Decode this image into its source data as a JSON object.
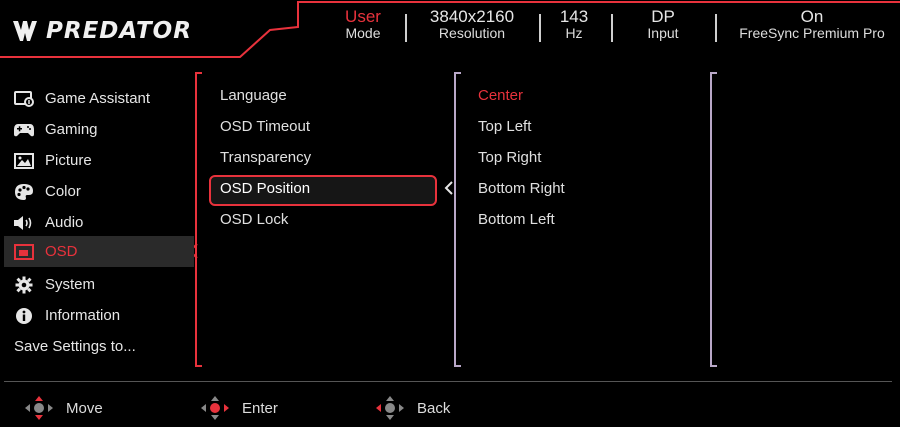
{
  "brand": {
    "name": "PREDATOR"
  },
  "status_bar": [
    {
      "value": "User",
      "label": "Mode",
      "value_color": "#e8323c"
    },
    {
      "value": "3840x2160",
      "label": "Resolution"
    },
    {
      "value": "143",
      "label": "Hz"
    },
    {
      "value": "DP",
      "label": "Input"
    },
    {
      "value": "On",
      "label": "FreeSync Premium Pro"
    }
  ],
  "main_menu": [
    {
      "label": "Game Assistant",
      "icon": "game-assistant-icon"
    },
    {
      "label": "Gaming",
      "icon": "gamepad-icon"
    },
    {
      "label": "Picture",
      "icon": "picture-icon"
    },
    {
      "label": "Color",
      "icon": "palette-icon"
    },
    {
      "label": "Audio",
      "icon": "speaker-icon"
    },
    {
      "label": "OSD",
      "icon": "osd-icon",
      "selected": true
    },
    {
      "label": "System",
      "icon": "gear-icon"
    },
    {
      "label": "Information",
      "icon": "info-icon"
    },
    {
      "label": "Save Settings to..."
    }
  ],
  "osd_submenu": [
    {
      "label": "Language"
    },
    {
      "label": "OSD Timeout"
    },
    {
      "label": "Transparency"
    },
    {
      "label": "OSD Position",
      "selected": true
    },
    {
      "label": "OSD Lock"
    }
  ],
  "osd_position_options": [
    {
      "label": "Center",
      "active": true
    },
    {
      "label": "Top Left"
    },
    {
      "label": "Top Right"
    },
    {
      "label": "Bottom Right"
    },
    {
      "label": "Bottom Left"
    }
  ],
  "footer_hints": [
    {
      "label": "Move",
      "icon": "dpad-move-icon"
    },
    {
      "label": "Enter",
      "icon": "dpad-enter-icon"
    },
    {
      "label": "Back",
      "icon": "dpad-back-icon"
    }
  ],
  "colors": {
    "accent": "#e8323c",
    "panel_bracket": "#b9a8c8"
  }
}
